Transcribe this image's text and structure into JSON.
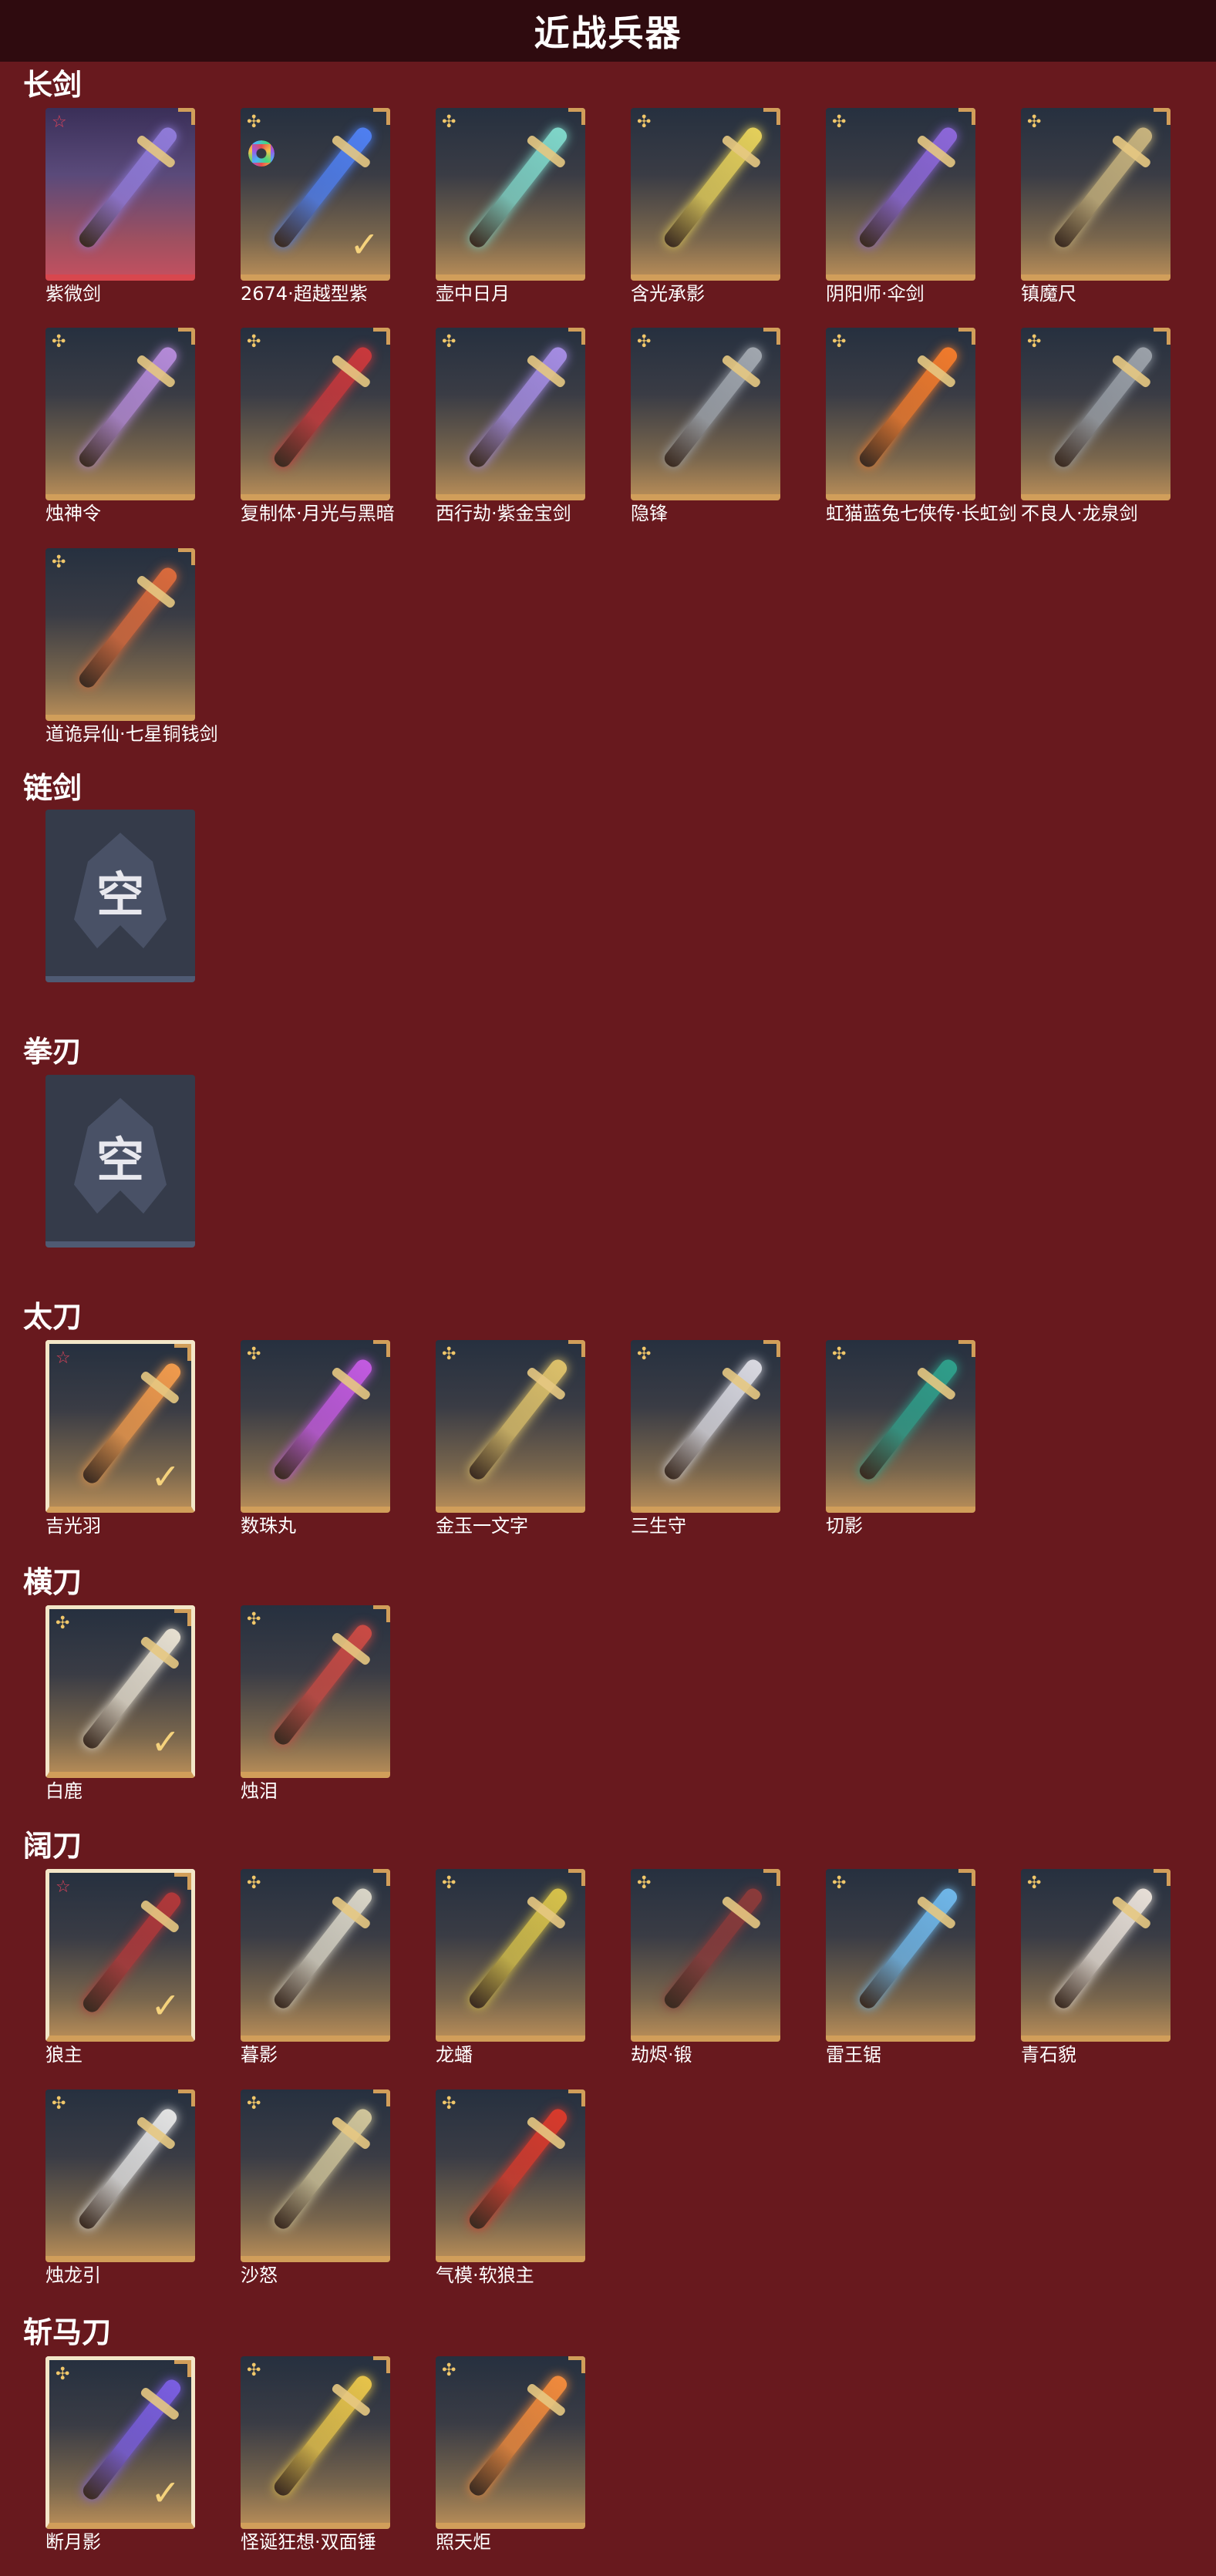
{
  "header": {
    "title": "近战兵器"
  },
  "colors": {
    "background": "#68191e",
    "header": "#2f0b0f",
    "accent_gold": "#d19e5a",
    "accent_red": "#d8474e"
  },
  "sections": [
    {
      "title": "长剑",
      "items": [
        {
          "label": "紫微剑",
          "rarity": "star",
          "style": "red",
          "blade": "#8f7ad8"
        },
        {
          "label": "2674·超越型紫",
          "rarity": "petal",
          "style": "normal",
          "blade": "#4f7ff0",
          "ring": true,
          "checked": true
        },
        {
          "label": "壶中日月",
          "rarity": "petal",
          "style": "normal",
          "blade": "#7fd6c9"
        },
        {
          "label": "含光承影",
          "rarity": "petal",
          "style": "normal",
          "blade": "#e4cf5a"
        },
        {
          "label": "阴阳师·伞剑",
          "rarity": "petal",
          "style": "normal",
          "blade": "#8c67d9"
        },
        {
          "label": "镇魔尺",
          "rarity": "petal",
          "style": "normal",
          "blade": "#c6b27d"
        },
        {
          "label": "烛神令",
          "rarity": "petal",
          "style": "normal",
          "blade": "#b48ad8"
        },
        {
          "label": "复制体·月光与黑暗",
          "rarity": "petal",
          "style": "normal",
          "blade": "#c8383c"
        },
        {
          "label": "西行劫·紫金宝剑",
          "rarity": "petal",
          "style": "normal",
          "blade": "#a48ce2"
        },
        {
          "label": "隐锋",
          "rarity": "petal",
          "style": "normal",
          "blade": "#a0a6ae"
        },
        {
          "label": "虹猫蓝兔七侠传·长虹剑",
          "rarity": "petal",
          "style": "normal",
          "blade": "#f07a2c"
        },
        {
          "label": "不良人·龙泉剑",
          "rarity": "petal",
          "style": "normal",
          "blade": "#9aa0a8"
        },
        {
          "label": "道诡异仙·七星铜钱剑",
          "rarity": "petal",
          "style": "normal",
          "blade": "#d96a3c"
        }
      ]
    },
    {
      "title": "链剑",
      "items": [
        {
          "label": "",
          "empty": true,
          "empty_text": "空"
        }
      ]
    },
    {
      "title": "拳刃",
      "items": [
        {
          "label": "",
          "empty": true,
          "empty_text": "空"
        }
      ]
    },
    {
      "title": "太刀",
      "items": [
        {
          "label": "吉光羽",
          "rarity": "star",
          "style": "selected",
          "blade": "#f09a4c",
          "checked": true
        },
        {
          "label": "数珠丸",
          "rarity": "petal",
          "style": "normal",
          "blade": "#c25ae0"
        },
        {
          "label": "金玉一文字",
          "rarity": "petal",
          "style": "normal",
          "blade": "#dcc06a"
        },
        {
          "label": "三生守",
          "rarity": "petal",
          "style": "normal",
          "blade": "#d8d8e0"
        },
        {
          "label": "切影",
          "rarity": "petal",
          "style": "normal",
          "blade": "#2f9e8a"
        }
      ]
    },
    {
      "title": "横刀",
      "items": [
        {
          "label": "白鹿",
          "rarity": "petal",
          "style": "selected",
          "blade": "#e6dfd0",
          "checked": true
        },
        {
          "label": "烛泪",
          "rarity": "petal",
          "style": "normal",
          "blade": "#c94a44"
        }
      ]
    },
    {
      "title": "阔刀",
      "items": [
        {
          "label": "狼主",
          "rarity": "star",
          "style": "selected",
          "blade": "#b0383a",
          "checked": true
        },
        {
          "label": "暮影",
          "rarity": "petal",
          "style": "normal",
          "blade": "#d8d4c6"
        },
        {
          "label": "龙蟠",
          "rarity": "petal",
          "style": "normal",
          "blade": "#d6c14a"
        },
        {
          "label": "劫烬·锻",
          "rarity": "petal",
          "style": "normal",
          "blade": "#8a3a3a"
        },
        {
          "label": "雷王锯",
          "rarity": "petal",
          "style": "normal",
          "blade": "#6fb6e8"
        },
        {
          "label": "青石貌",
          "rarity": "petal",
          "style": "normal",
          "blade": "#e6ded6"
        },
        {
          "label": "烛龙引",
          "rarity": "petal",
          "style": "normal",
          "blade": "#e2e2e2"
        },
        {
          "label": "沙怒",
          "rarity": "petal",
          "style": "normal",
          "blade": "#cfc49a"
        },
        {
          "label": "气模·软狼主",
          "rarity": "petal",
          "style": "normal",
          "blade": "#d83a2c"
        }
      ]
    },
    {
      "title": "斩马刀",
      "items": [
        {
          "label": "断月影",
          "rarity": "petal",
          "style": "selected",
          "blade": "#7a5ee0",
          "checked": true
        },
        {
          "label": "怪诞狂想·双面锤",
          "rarity": "petal",
          "style": "normal",
          "blade": "#e6c34a"
        },
        {
          "label": "照天炬",
          "rarity": "petal",
          "style": "normal",
          "blade": "#f08a3c"
        }
      ]
    }
  ],
  "icons": {
    "rarity_star": "☆",
    "rarity_petal": "✣",
    "check": "✓"
  }
}
